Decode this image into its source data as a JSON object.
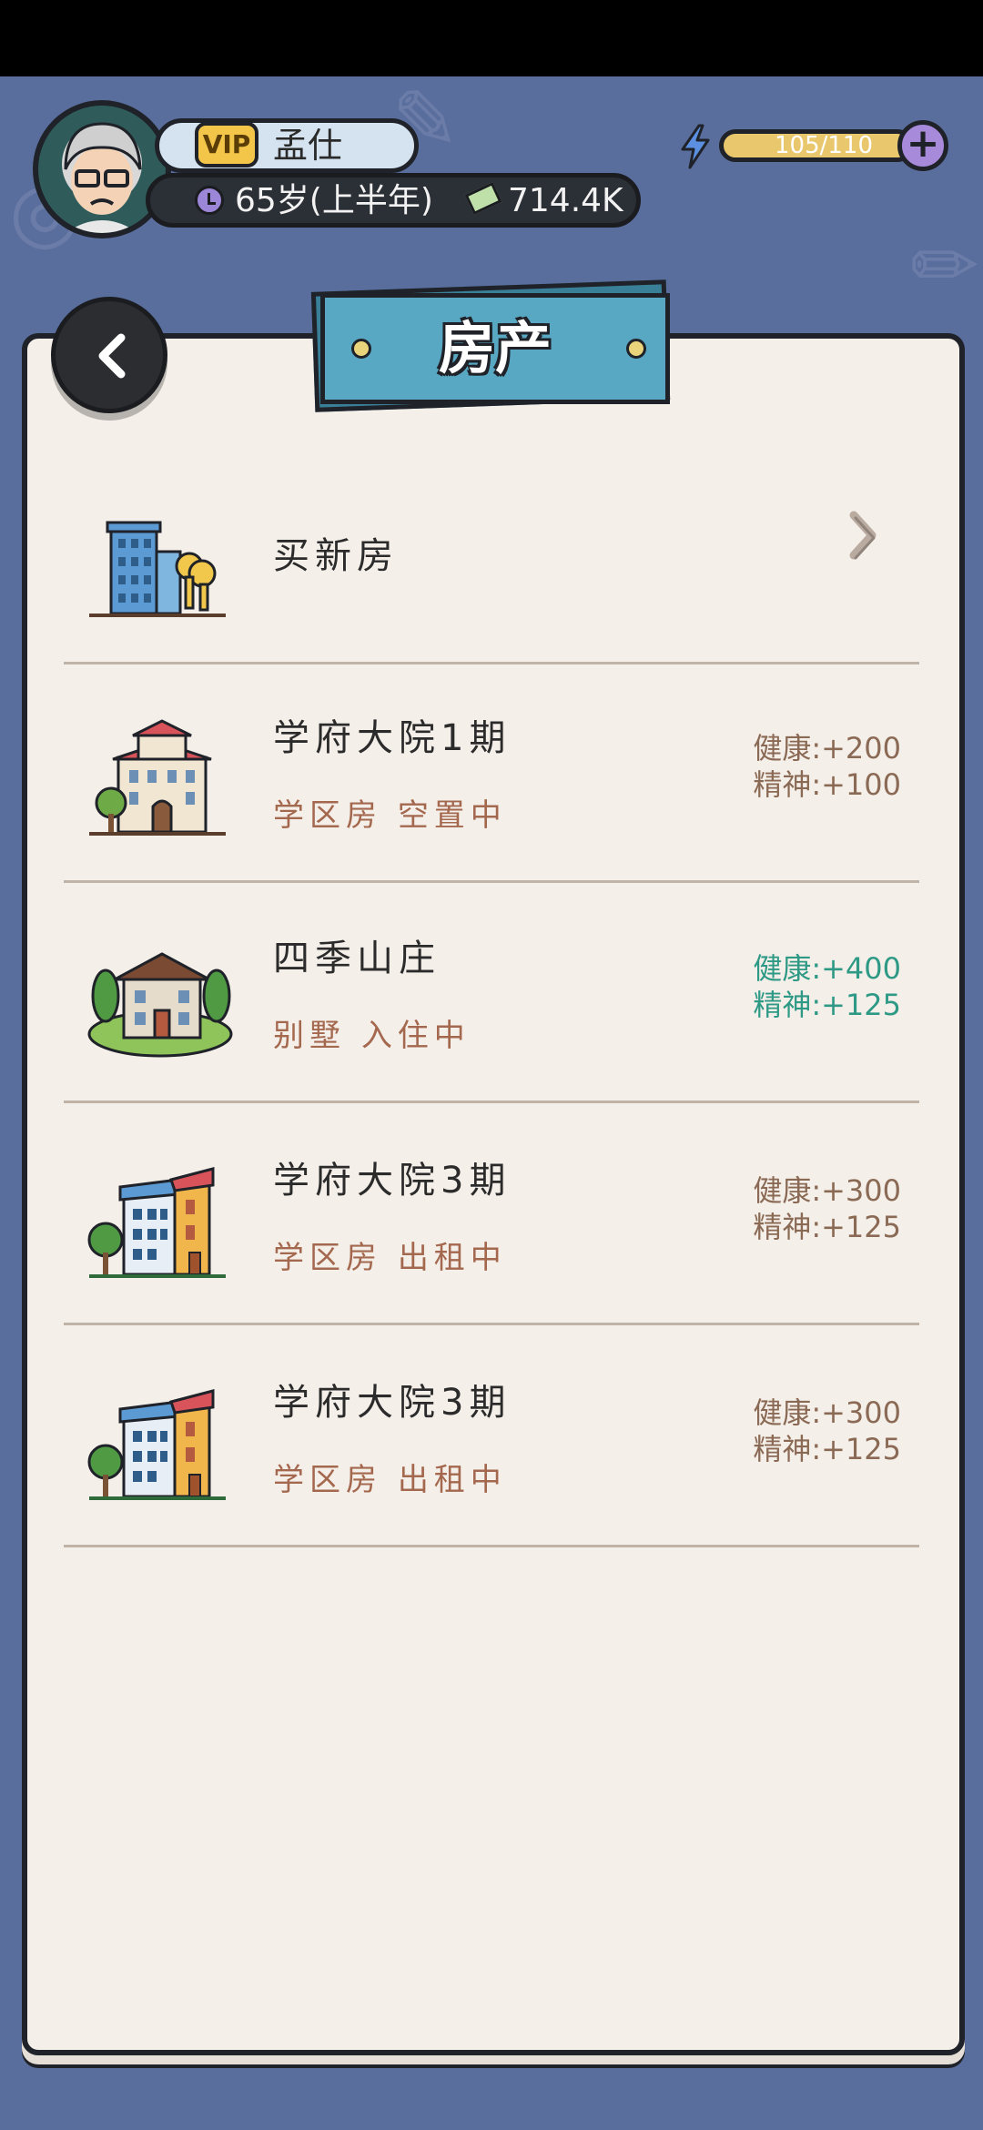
{
  "header": {
    "vip_label": "VIP",
    "player_name": "孟仕",
    "age": "65岁(上半年)",
    "cash": "714.4K",
    "energy": "105/110",
    "energy_plus_label": "+"
  },
  "page": {
    "title": "房产"
  },
  "buy_row": {
    "label": "买新房"
  },
  "properties": [
    {
      "name": "学府大院1期",
      "type": "学区房",
      "status": "空置中",
      "health": "健康:+200",
      "spirit": "精神:+100",
      "bonus_color": "#8a6a55",
      "icon": "apartment-building-icon"
    },
    {
      "name": "四季山庄",
      "type": "别墅",
      "status": "入住中",
      "health": "健康:+400",
      "spirit": "精神:+125",
      "bonus_color": "#2e9a86",
      "icon": "villa-house-icon"
    },
    {
      "name": "学府大院3期",
      "type": "学区房",
      "status": "出租中",
      "health": "健康:+300",
      "spirit": "精神:+125",
      "bonus_color": "#8a6a55",
      "icon": "school-district-building-icon"
    },
    {
      "name": "学府大院3期",
      "type": "学区房",
      "status": "出租中",
      "health": "健康:+300",
      "spirit": "精神:+125",
      "bonus_color": "#8a6a55",
      "icon": "school-district-building-icon"
    }
  ],
  "colors": {
    "background": "#5a6e9e",
    "panel": "#f5efe9",
    "title_plate": "#58a8c4",
    "status_text": "#a4684f",
    "active_bonus": "#2e9a86"
  }
}
